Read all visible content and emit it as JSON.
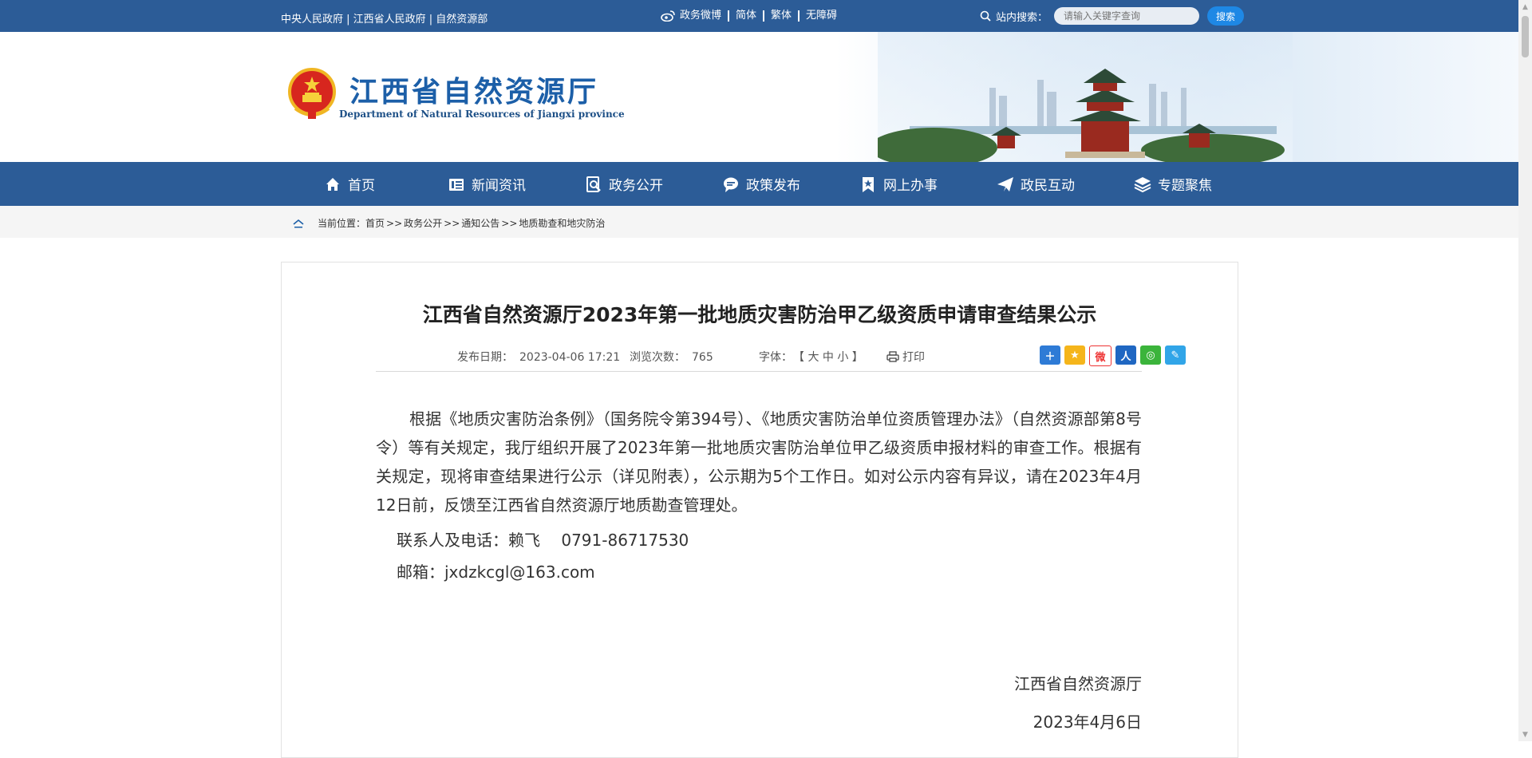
{
  "topbar": {
    "links": "中央人民政府 | 江西省人民政府 | 自然资源部",
    "weibo": "政务微博",
    "simplified": "简体",
    "traditional": "繁体",
    "accessibility": "无障碍",
    "search_label": "站内搜索：",
    "search_placeholder": "请输入关键字查询",
    "search_button": "搜索"
  },
  "header": {
    "title": "江西省自然资源厅",
    "subtitle": "Department of Natural Resources of Jiangxi province"
  },
  "nav": [
    {
      "label": "首页",
      "icon": "home-icon"
    },
    {
      "label": "新闻资讯",
      "icon": "news-icon"
    },
    {
      "label": "政务公开",
      "icon": "search-doc-icon"
    },
    {
      "label": "政策发布",
      "icon": "chat-icon"
    },
    {
      "label": "网上办事",
      "icon": "bookmark-star-icon"
    },
    {
      "label": "政民互动",
      "icon": "paper-plane-icon"
    },
    {
      "label": "专题聚焦",
      "icon": "layers-icon"
    }
  ],
  "breadcrumb": {
    "prefix": "当前位置：",
    "items": [
      "首页",
      "政务公开",
      "通知公告",
      "地质勘查和地灾防治"
    ],
    "separator": ">>"
  },
  "article": {
    "title": "江西省自然资源厅2023年第一批地质灾害防治甲乙级资质申请审查结果公示",
    "publish_label": "发布日期：",
    "publish_date": "2023-04-06 17:21",
    "views_label": "浏览次数：",
    "views": "765",
    "font_label": "字体：",
    "font_sizes": "【 大 中 小 】",
    "print": "打印",
    "share_icons": [
      "plus-share-icon",
      "qzone-icon",
      "weibo-icon",
      "renren-icon",
      "wechat-icon",
      "pencil-share-icon"
    ],
    "paragraph": "根据《地质灾害防治条例》（国务院令第394号）、《地质灾害防治单位资质管理办法》（自然资源部第8号令）等有关规定，我厅组织开展了2023年第一批地质灾害防治单位甲乙级资质申报材料的审查工作。根据有关规定，现将审查结果进行公示（详见附表），公示期为5个工作日。如对公示内容有异议，请在2023年4月12日前，反馈至江西省自然资源厅地质勘查管理处。",
    "contact": "联系人及电话：赖飞　  0791-86717530",
    "email": "邮箱：jxdzkcgl@163.com",
    "signature_org": "江西省自然资源厅",
    "signature_date": "2023年4月6日"
  },
  "colors": {
    "primary": "#2c5c97",
    "title_blue": "#1c5fa8",
    "search_button": "#1e88e5"
  }
}
